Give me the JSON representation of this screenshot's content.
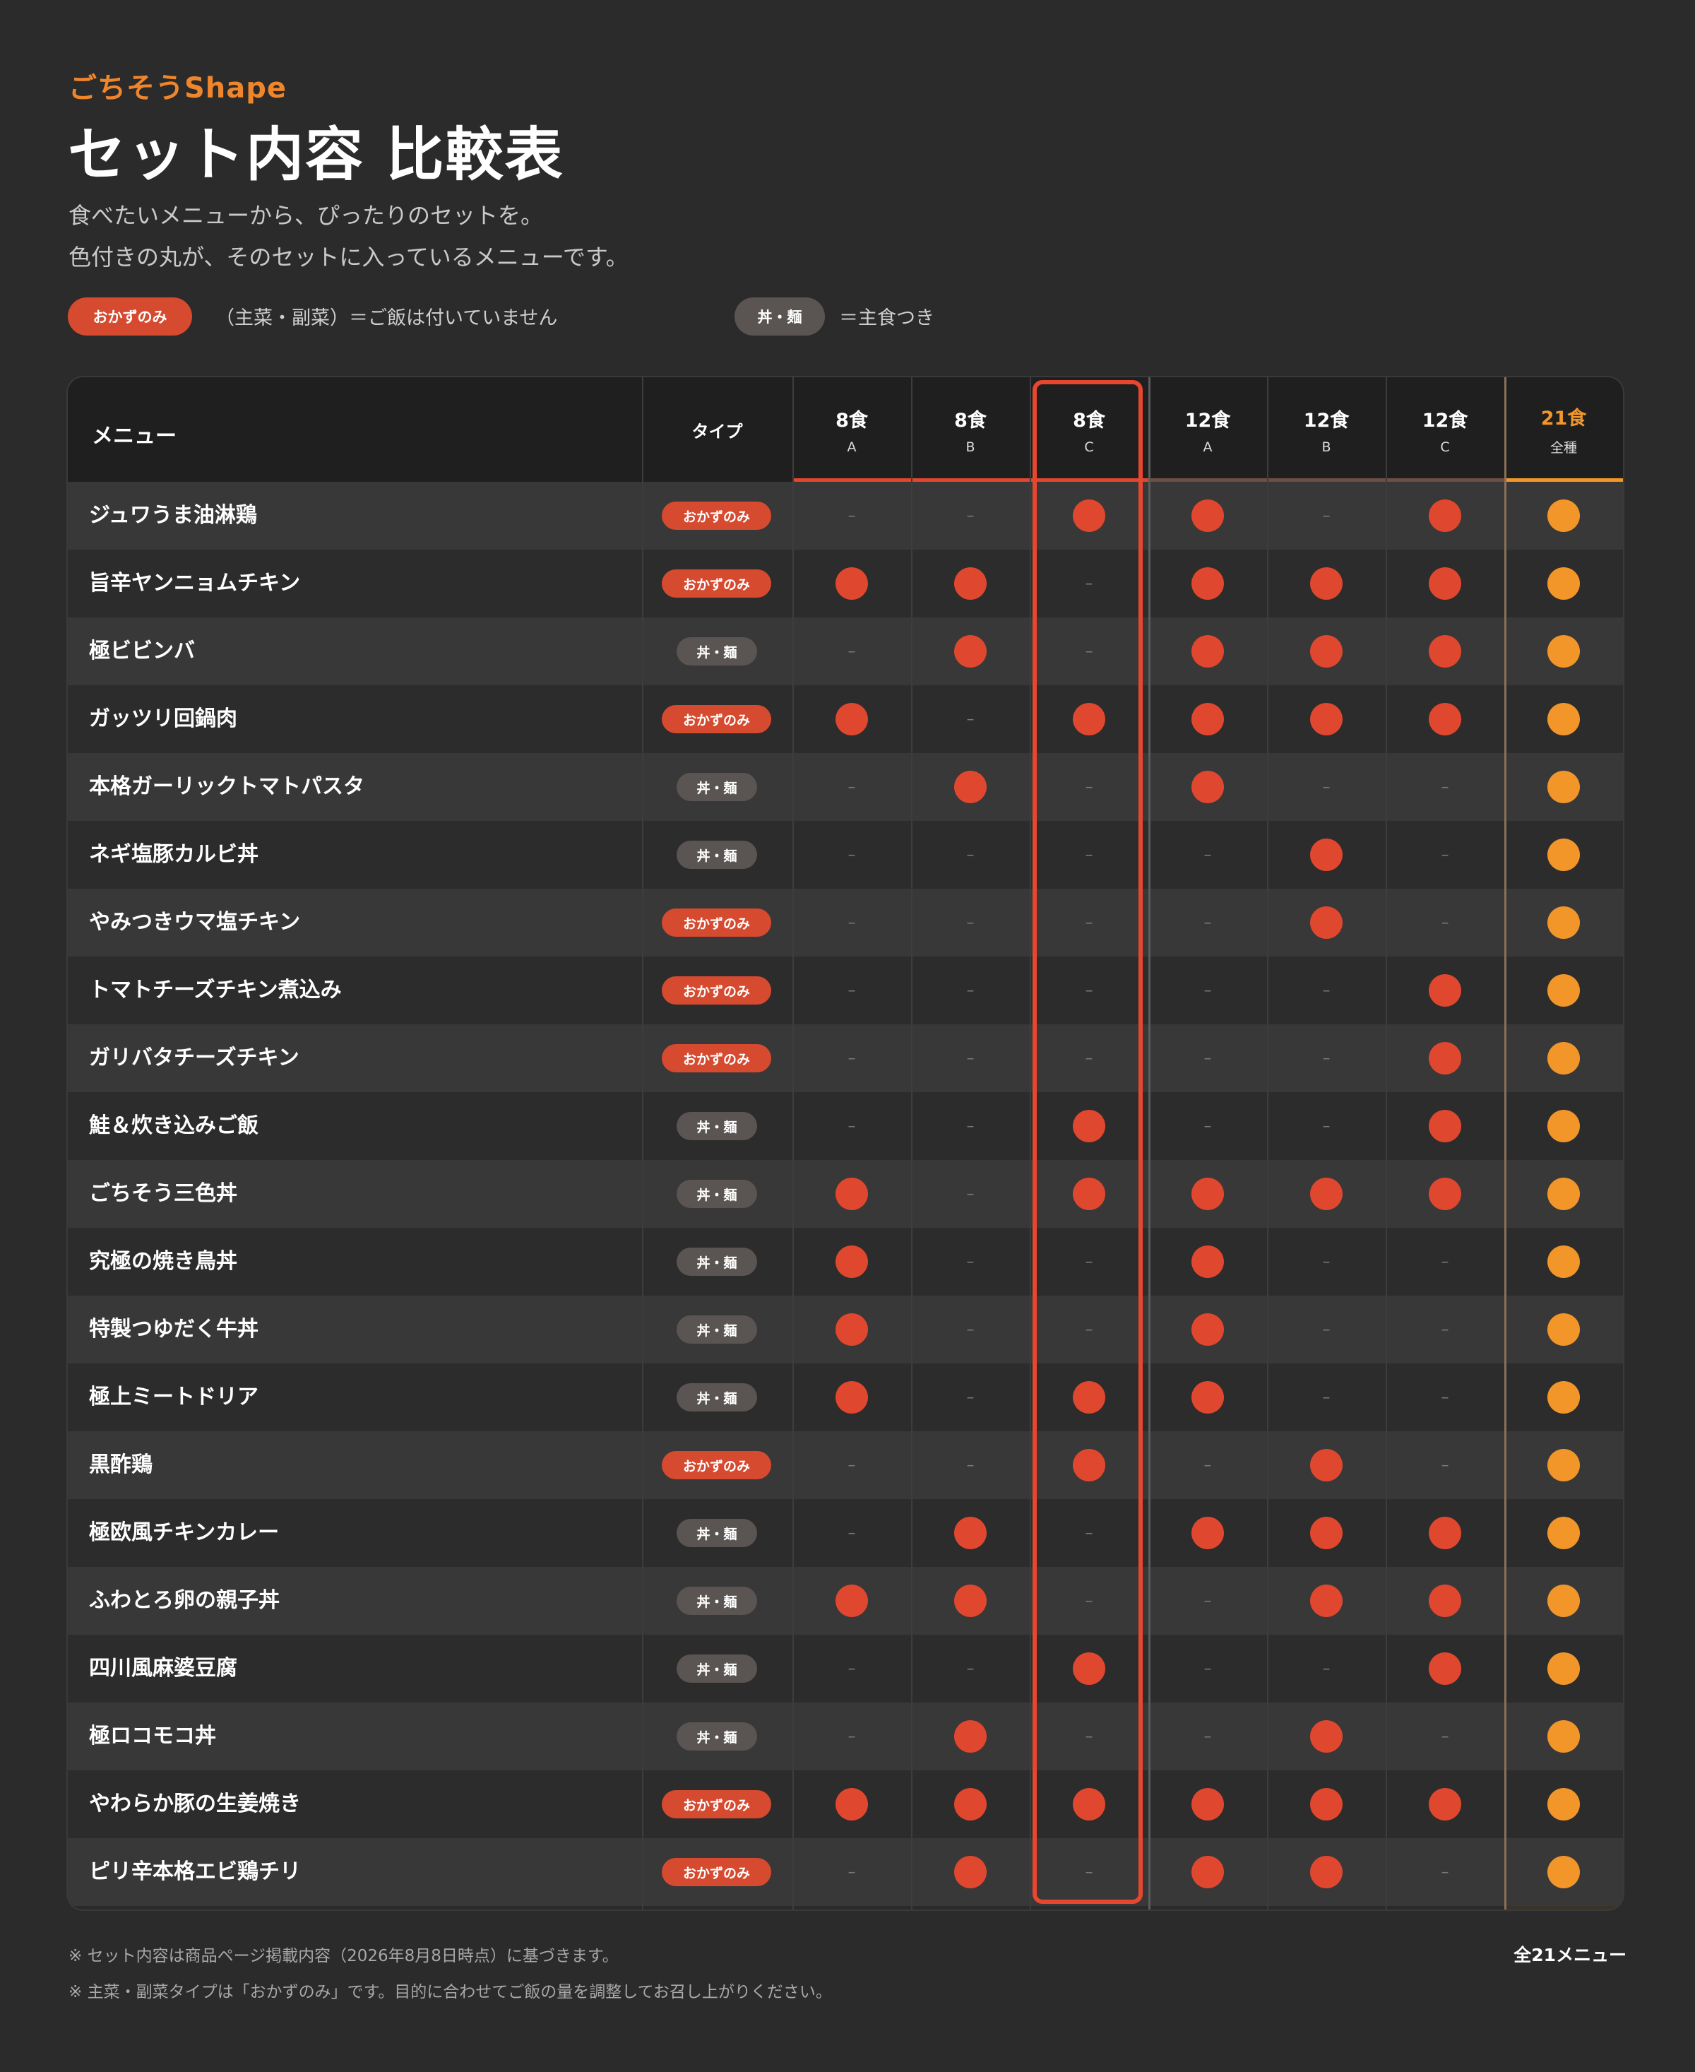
{
  "header": {
    "brand": "ごちそうShape",
    "title": "セット内容 比較表",
    "subtitle1": "食べたいメニューから、ぴったりのセットを。",
    "subtitle2": "色付きの丸が、そのセットに入っているメニューです。"
  },
  "legend": {
    "okazu_label": "おかずのみ",
    "okazu_desc": "（主菜・副菜）＝ご飯は付いていません",
    "don_label": "丼・麺",
    "don_desc": "＝主食つき"
  },
  "table": {
    "menu_header": "メニュー",
    "type_header": "タイプ",
    "columns": [
      {
        "main": "8食",
        "sub": "A",
        "accent": "#e0472f"
      },
      {
        "main": "8食",
        "sub": "B",
        "accent": "#e0472f"
      },
      {
        "main": "8食",
        "sub": "C",
        "accent": "#e0472f"
      },
      {
        "main": "12食",
        "sub": "A",
        "accent": "#6e4e45"
      },
      {
        "main": "12食",
        "sub": "B",
        "accent": "#6e4e45"
      },
      {
        "main": "12食",
        "sub": "C",
        "accent": "#6e4e45"
      },
      {
        "main": "21食",
        "sub": "全種",
        "accent": "#f2962a"
      }
    ],
    "dash": "–",
    "rows": [
      {
        "name": "ジュワうま油淋鶏",
        "type": "okazu",
        "type_label": "おかずのみ",
        "sets": [
          0,
          0,
          1,
          1,
          0,
          1,
          1
        ]
      },
      {
        "name": "旨辛ヤンニョムチキン",
        "type": "okazu",
        "type_label": "おかずのみ",
        "sets": [
          1,
          1,
          0,
          1,
          1,
          1,
          1
        ]
      },
      {
        "name": "極ビビンバ",
        "type": "don",
        "type_label": "丼・麺",
        "sets": [
          0,
          1,
          0,
          1,
          1,
          1,
          1
        ]
      },
      {
        "name": "ガッツリ回鍋肉",
        "type": "okazu",
        "type_label": "おかずのみ",
        "sets": [
          1,
          0,
          1,
          1,
          1,
          1,
          1
        ]
      },
      {
        "name": "本格ガーリックトマトパスタ",
        "type": "don",
        "type_label": "丼・麺",
        "sets": [
          0,
          1,
          0,
          1,
          0,
          0,
          1
        ]
      },
      {
        "name": "ネギ塩豚カルビ丼",
        "type": "don",
        "type_label": "丼・麺",
        "sets": [
          0,
          0,
          0,
          0,
          1,
          0,
          1
        ]
      },
      {
        "name": "やみつきウマ塩チキン",
        "type": "okazu",
        "type_label": "おかずのみ",
        "sets": [
          0,
          0,
          0,
          0,
          1,
          0,
          1
        ]
      },
      {
        "name": "トマトチーズチキン煮込み",
        "type": "okazu",
        "type_label": "おかずのみ",
        "sets": [
          0,
          0,
          0,
          0,
          0,
          1,
          1
        ]
      },
      {
        "name": "ガリバタチーズチキン",
        "type": "okazu",
        "type_label": "おかずのみ",
        "sets": [
          0,
          0,
          0,
          0,
          0,
          1,
          1
        ]
      },
      {
        "name": "鮭＆炊き込みご飯",
        "type": "don",
        "type_label": "丼・麺",
        "sets": [
          0,
          0,
          1,
          0,
          0,
          1,
          1
        ]
      },
      {
        "name": "ごちそう三色丼",
        "type": "don",
        "type_label": "丼・麺",
        "sets": [
          1,
          0,
          1,
          1,
          1,
          1,
          1
        ]
      },
      {
        "name": "究極の焼き鳥丼",
        "type": "don",
        "type_label": "丼・麺",
        "sets": [
          1,
          0,
          0,
          1,
          0,
          0,
          1
        ]
      },
      {
        "name": "特製つゆだく牛丼",
        "type": "don",
        "type_label": "丼・麺",
        "sets": [
          1,
          0,
          0,
          1,
          0,
          0,
          1
        ]
      },
      {
        "name": "極上ミートドリア",
        "type": "don",
        "type_label": "丼・麺",
        "sets": [
          1,
          0,
          1,
          1,
          0,
          0,
          1
        ]
      },
      {
        "name": "黒酢鶏",
        "type": "okazu",
        "type_label": "おかずのみ",
        "sets": [
          0,
          0,
          1,
          0,
          1,
          0,
          1
        ]
      },
      {
        "name": "極欧風チキンカレー",
        "type": "don",
        "type_label": "丼・麺",
        "sets": [
          0,
          1,
          0,
          1,
          1,
          1,
          1
        ]
      },
      {
        "name": "ふわとろ卵の親子丼",
        "type": "don",
        "type_label": "丼・麺",
        "sets": [
          1,
          1,
          0,
          0,
          1,
          1,
          1
        ]
      },
      {
        "name": "四川風麻婆豆腐",
        "type": "don",
        "type_label": "丼・麺",
        "sets": [
          0,
          0,
          1,
          0,
          0,
          1,
          1
        ]
      },
      {
        "name": "極ロコモコ丼",
        "type": "don",
        "type_label": "丼・麺",
        "sets": [
          0,
          1,
          0,
          0,
          1,
          0,
          1
        ]
      },
      {
        "name": "やわらか豚の生姜焼き",
        "type": "okazu",
        "type_label": "おかずのみ",
        "sets": [
          1,
          1,
          1,
          1,
          1,
          1,
          1
        ]
      },
      {
        "name": "ピリ辛本格エビ鶏チリ",
        "type": "okazu",
        "type_label": "おかずのみ",
        "sets": [
          0,
          1,
          0,
          1,
          1,
          0,
          1
        ]
      }
    ]
  },
  "footer": {
    "note1": "※ セット内容は商品ページ掲載内容（2026年8月8日時点）に基づきます。",
    "note2": "※ 主菜・副菜タイプは「おかずのみ」です。目的に合わせてご飯の量を調整してお召し上がりください。",
    "total": "全21メニュー"
  },
  "colors": {
    "background": "#2b2b2b",
    "red_dot": "#e0472f",
    "orange_dot": "#f2962a",
    "brand": "#f0862c",
    "highlight": "#e8472f"
  }
}
